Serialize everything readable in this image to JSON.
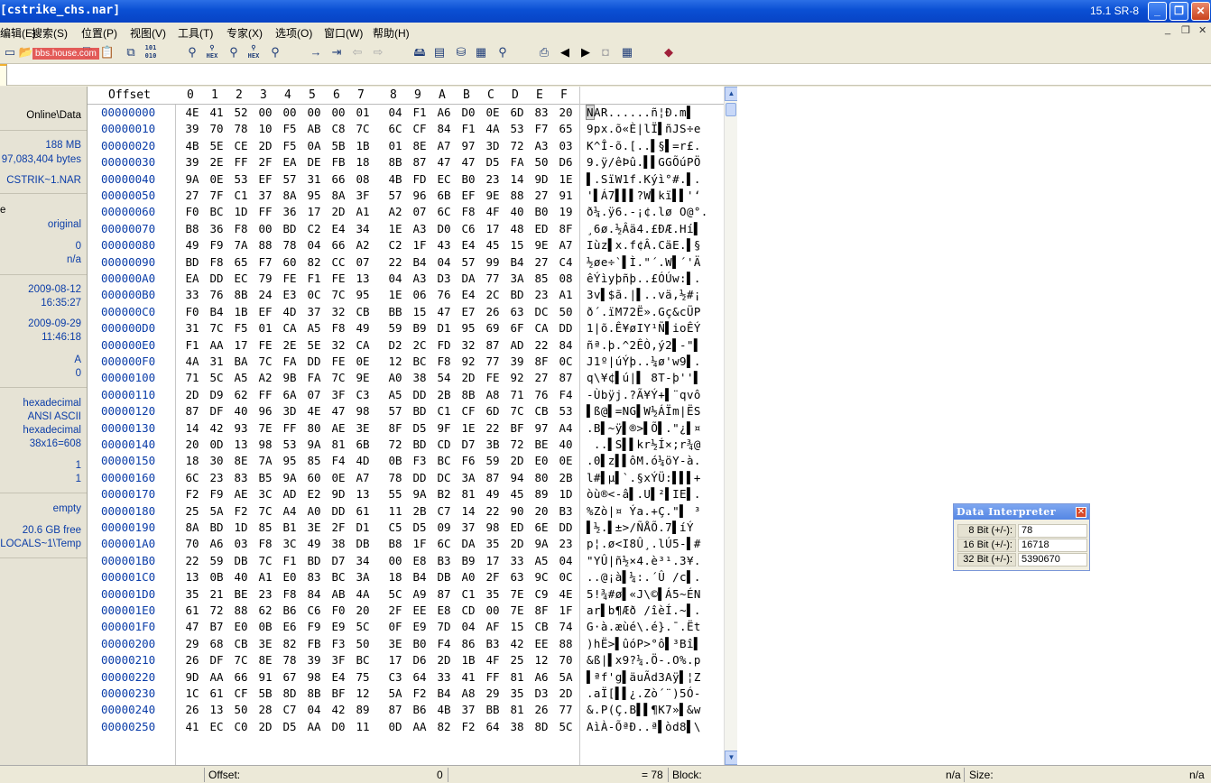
{
  "window": {
    "title": "[cstrike_chs.nar]",
    "version": "15.1 SR-8"
  },
  "menu": [
    {
      "label": "编辑(E)"
    },
    {
      "label": "搜索(S)"
    },
    {
      "label": "位置(P)"
    },
    {
      "label": "视图(V)"
    },
    {
      "label": "工具(T)"
    },
    {
      "label": "专家(X)"
    },
    {
      "label": "选项(O)"
    },
    {
      "label": "窗口(W)"
    },
    {
      "label": "帮助(H)"
    }
  ],
  "watermark": "bbs.house.com",
  "side_panel": {
    "path": "Online\\Data",
    "size_mb": "188 MB",
    "size_bytes": "97,083,404 bytes",
    "dos_name": "CSTRIK~1.NAR",
    "mode_label": "e",
    "mode": "original",
    "undo_level": "0",
    "undo_reverses": "n/a",
    "created_date": "2009-08-12",
    "created_time": "16:35:27",
    "modified_date": "2009-09-29",
    "modified_time": "11:46:18",
    "attr": "A",
    "icons": "0",
    "offsets_mode": "hexadecimal",
    "charset": "ANSI ASCII",
    "offsets_fmt": "hexadecimal",
    "bytes_per_page": "38x16=608",
    "window_num": "1",
    "window_count": "1",
    "clipboard": "empty",
    "free_space": "20.6 GB free",
    "temp_folder": "LOCALS~1\\Temp"
  },
  "hex_header": {
    "offset_label": "Offset",
    "columns": [
      "0",
      "1",
      "2",
      "3",
      "4",
      "5",
      "6",
      "7",
      "8",
      "9",
      "A",
      "B",
      "C",
      "D",
      "E",
      "F"
    ]
  },
  "hex_rows": [
    {
      "off": "00000000",
      "bytes": "4E 41 52 00 00 00 00 01 04 F1 A6 D0 0E 6D 83 20",
      "text": "NAR......ñ¦Ð.m▌"
    },
    {
      "off": "00000010",
      "bytes": "39 70 78 10 F5 AB C8 7C 6C CF 84 F1 4A 53 F7 65",
      "text": "9px.õ«È|lÏ▌ñJS÷e"
    },
    {
      "off": "00000020",
      "bytes": "4B 5E CE 2D F5 0A 5B 1B 01 8E A7 97 3D 72 A3 03",
      "text": "K^Î-õ.[..▌§▌=r£."
    },
    {
      "off": "00000030",
      "bytes": "39 2E FF 2F EA DE FB 18 8B 87 47 47 D5 FA 50 D6",
      "text": "9.ÿ/êÞû.▌▌GGÕúPÖ"
    },
    {
      "off": "00000040",
      "bytes": "9A 0E 53 EF 57 31 66 08 4B FD EC B0 23 14 9D 1E",
      "text": "▌.SïW1f.Kýì°#.▌."
    },
    {
      "off": "00000050",
      "bytes": "27 7F C1 37 8A 95 8A 3F 57 96 6B EF 9E 88 27 91",
      "text": "'▌Á7▌▌▌?W▌kï▌▌'‘"
    },
    {
      "off": "00000060",
      "bytes": "F0 BC 1D FF 36 17 2D A1 A2 07 6C F8 4F 40 B0 19",
      "text": "ð¼.ÿ6.-¡¢.lø O@°."
    },
    {
      "off": "00000070",
      "bytes": "B8 36 F8 00 BD C2 E4 34 1E A3 D0 C6 17 48 ED 8F",
      "text": "¸6ø.½Âä4.£ÐÆ.Hí▌"
    },
    {
      "off": "00000080",
      "bytes": "49 F9 7A 88 78 04 66 A2 C2 1F 43 E4 45 15 9E A7",
      "text": "Iùz▌x.f¢Â.CäE.▌§"
    },
    {
      "off": "00000090",
      "bytes": "BD F8 65 F7 60 82 CC 07 22 B4 04 57 99 B4 27 C4",
      "text": "½øe÷`▌Ì.\"´.W▌´'Ä"
    },
    {
      "off": "000000A0",
      "bytes": "EA DD EC 79 FE F1 FE 13 04 A3 D3 DA 77 3A 85 08",
      "text": "êÝìyþñþ..£ÓÚw:▌."
    },
    {
      "off": "000000B0",
      "bytes": "33 76 8B 24 E3 0C 7C 95 1E 06 76 E4 2C BD 23 A1",
      "text": "3v▌$ã.|▌..vä,½#¡"
    },
    {
      "off": "000000C0",
      "bytes": "F0 B4 1B EF 4D 37 32 CB BB 15 47 E7 26 63 DC 50",
      "text": "ð´.ïM72Ë».Gç&cÜP"
    },
    {
      "off": "000000D0",
      "bytes": "31 7C F5 01 CA A5 F8 49 59 B9 D1 95 69 6F CA DD",
      "text": "1|õ.Ê¥øIY¹Ñ▌ioÊÝ"
    },
    {
      "off": "000000E0",
      "bytes": "F1 AA 17 FE 2E 5E 32 CA D2 2C FD 32 87 AD 22 84",
      "text": "ñª.þ.^2ÊÒ,ý2▌-\"▌"
    },
    {
      "off": "000000F0",
      "bytes": "4A 31 BA 7C FA DD FE 0E 12 BC F8 92 77 39 8F 0C",
      "text": "J1º|úÝþ..¼ø'w9▌."
    },
    {
      "off": "00000100",
      "bytes": "71 5C A5 A2 9B FA 7C 9E A0 38 54 2D FE 92 27 87",
      "text": "q\\¥¢▌ú|▌ 8T-þ''▌"
    },
    {
      "off": "00000110",
      "bytes": "2D D9 62 FF 6A 07 3F C3 A5 DD 2B 8B A8 71 76 F4",
      "text": "-Ùbÿj.?Ã¥Ý+▌¨qvô"
    },
    {
      "off": "00000120",
      "bytes": "87 DF 40 96 3D 4E 47 98 57 BD C1 CF 6D 7C CB 53",
      "text": "▌ß@▌=NG▌W½ÁÏm|ËS"
    },
    {
      "off": "00000130",
      "bytes": "14 42 93 7E FF 80 AE 3E 8F D5 9F 1E 22 BF 97 A4",
      "text": ".B▌~ÿ▌®>▌Õ▌.\"¿▌¤"
    },
    {
      "off": "00000140",
      "bytes": "20 0D 13 98 53 9A 81 6B 72 BD CD D7 3B 72 BE 40",
      "text": " ..▌S▌▌kr½Í×;r¾@"
    },
    {
      "off": "00000150",
      "bytes": "18 30 8E 7A 95 85 F4 4D 0B F3 BC F6 59 2D E0 0E",
      "text": ".0▌z▌▌ôM.ó¼öY-à."
    },
    {
      "off": "00000160",
      "bytes": "6C 23 83 B5 9A 60 0E A7 78 DD DC 3A 87 94 80 2B",
      "text": "l#▌µ▌`.§xÝÜ:▌▌▌+"
    },
    {
      "off": "00000170",
      "bytes": "F2 F9 AE 3C AD E2 9D 13 55 9A B2 81 49 45 89 1D",
      "text": "òù®<-â▌.U▌²▌IE▌."
    },
    {
      "off": "00000180",
      "bytes": "25 5A F2 7C A4 A0 DD 61 11 2B C7 14 22 90 20 B3",
      "text": "%Zò|¤ Ýa.+Ç.\"▌ ³"
    },
    {
      "off": "00000190",
      "bytes": "8A BD 1D 85 B1 3E 2F D1 C5 D5 09 37 98 ED 6E DD",
      "text": "▌½.▌±>/ÑÅÕ.7▌íÝ"
    },
    {
      "off": "000001A0",
      "bytes": "70 A6 03 F8 3C 49 38 DB B8 1F 6C DA 35 2D 9A 23",
      "text": "p¦.ø<I8Û¸.lÚ5-▌#"
    },
    {
      "off": "000001B0",
      "bytes": "22 59 DB 7C F1 BD D7 34 00 E8 B3 B9 17 33 A5 04",
      "text": "\"YÛ|ñ½×4.è³¹.3¥."
    },
    {
      "off": "000001C0",
      "bytes": "13 0B 40 A1 E0 83 BC 3A 18 B4 DB A0 2F 63 9C 0C",
      "text": "..@¡à▌¼:.´Û /c▌."
    },
    {
      "off": "000001D0",
      "bytes": "35 21 BE 23 F8 84 AB 4A 5C A9 87 C1 35 7E C9 4E",
      "text": "5!¾#ø▌«J\\©▌Á5~ÉN"
    },
    {
      "off": "000001E0",
      "bytes": "61 72 88 62 B6 C6 F0 20 2F EE E8 CD 00 7E 8F 1F",
      "text": "ar▌b¶Æð /îèÍ.~▌."
    },
    {
      "off": "000001F0",
      "bytes": "47 B7 E0 0B E6 F9 E9 5C 0F E9 7D 04 AF 15 CB 74",
      "text": "G·à.æùé\\.é}.¯.Ët"
    },
    {
      "off": "00000200",
      "bytes": "29 68 CB 3E 82 FB F3 50 3E B0 F4 86 B3 42 EE 88",
      "text": ")hË>▌ûóP>°ô▌³Bî▌"
    },
    {
      "off": "00000210",
      "bytes": "26 DF 7C 8E 78 39 3F BC 17 D6 2D 1B 4F 25 12 70",
      "text": "&ß|▌x9?¼.Ö-.O%.p"
    },
    {
      "off": "00000220",
      "bytes": "9D AA 66 91 67 98 E4 75 C3 64 33 41 FF 81 A6 5A",
      "text": "▌ªf'g▌äuÃd3Aÿ▌¦Z"
    },
    {
      "off": "00000230",
      "bytes": "1C 61 CF 5B 8D 8B BF 12 5A F2 B4 A8 29 35 D3 2D",
      "text": ".aÏ[▌▌¿.Zò´¨)5Ó-"
    },
    {
      "off": "00000240",
      "bytes": "26 13 50 28 C7 04 42 89 87 B6 4B 37 BB 81 26 77",
      "text": "&.P(Ç.B▌▌¶K7»▌&w"
    },
    {
      "off": "00000250",
      "bytes": "41 EC C0 2D D5 AA D0 11 0D AA 82 F2 64 38 8D 5C",
      "text": "AìÀ-ÕªÐ..ª▌òd8▌\\"
    }
  ],
  "data_interpreter": {
    "title": "Data Interpreter",
    "rows": [
      {
        "label": "8 Bit (+/-):",
        "value": "78"
      },
      {
        "label": "16 Bit (+/-):",
        "value": "16718"
      },
      {
        "label": "32 Bit (+/-):",
        "value": "5390670"
      }
    ]
  },
  "status": {
    "offset_label": "Offset:",
    "offset_value": "0",
    "byte_value": "= 78",
    "block_label": "Block:",
    "block_value": "n/a",
    "size_label": "Size:",
    "size_value": "n/a"
  },
  "colors": {
    "titlebar": "#0a4fd3",
    "offset_text": "#0b3da8",
    "side_text": "#0b3da8"
  }
}
